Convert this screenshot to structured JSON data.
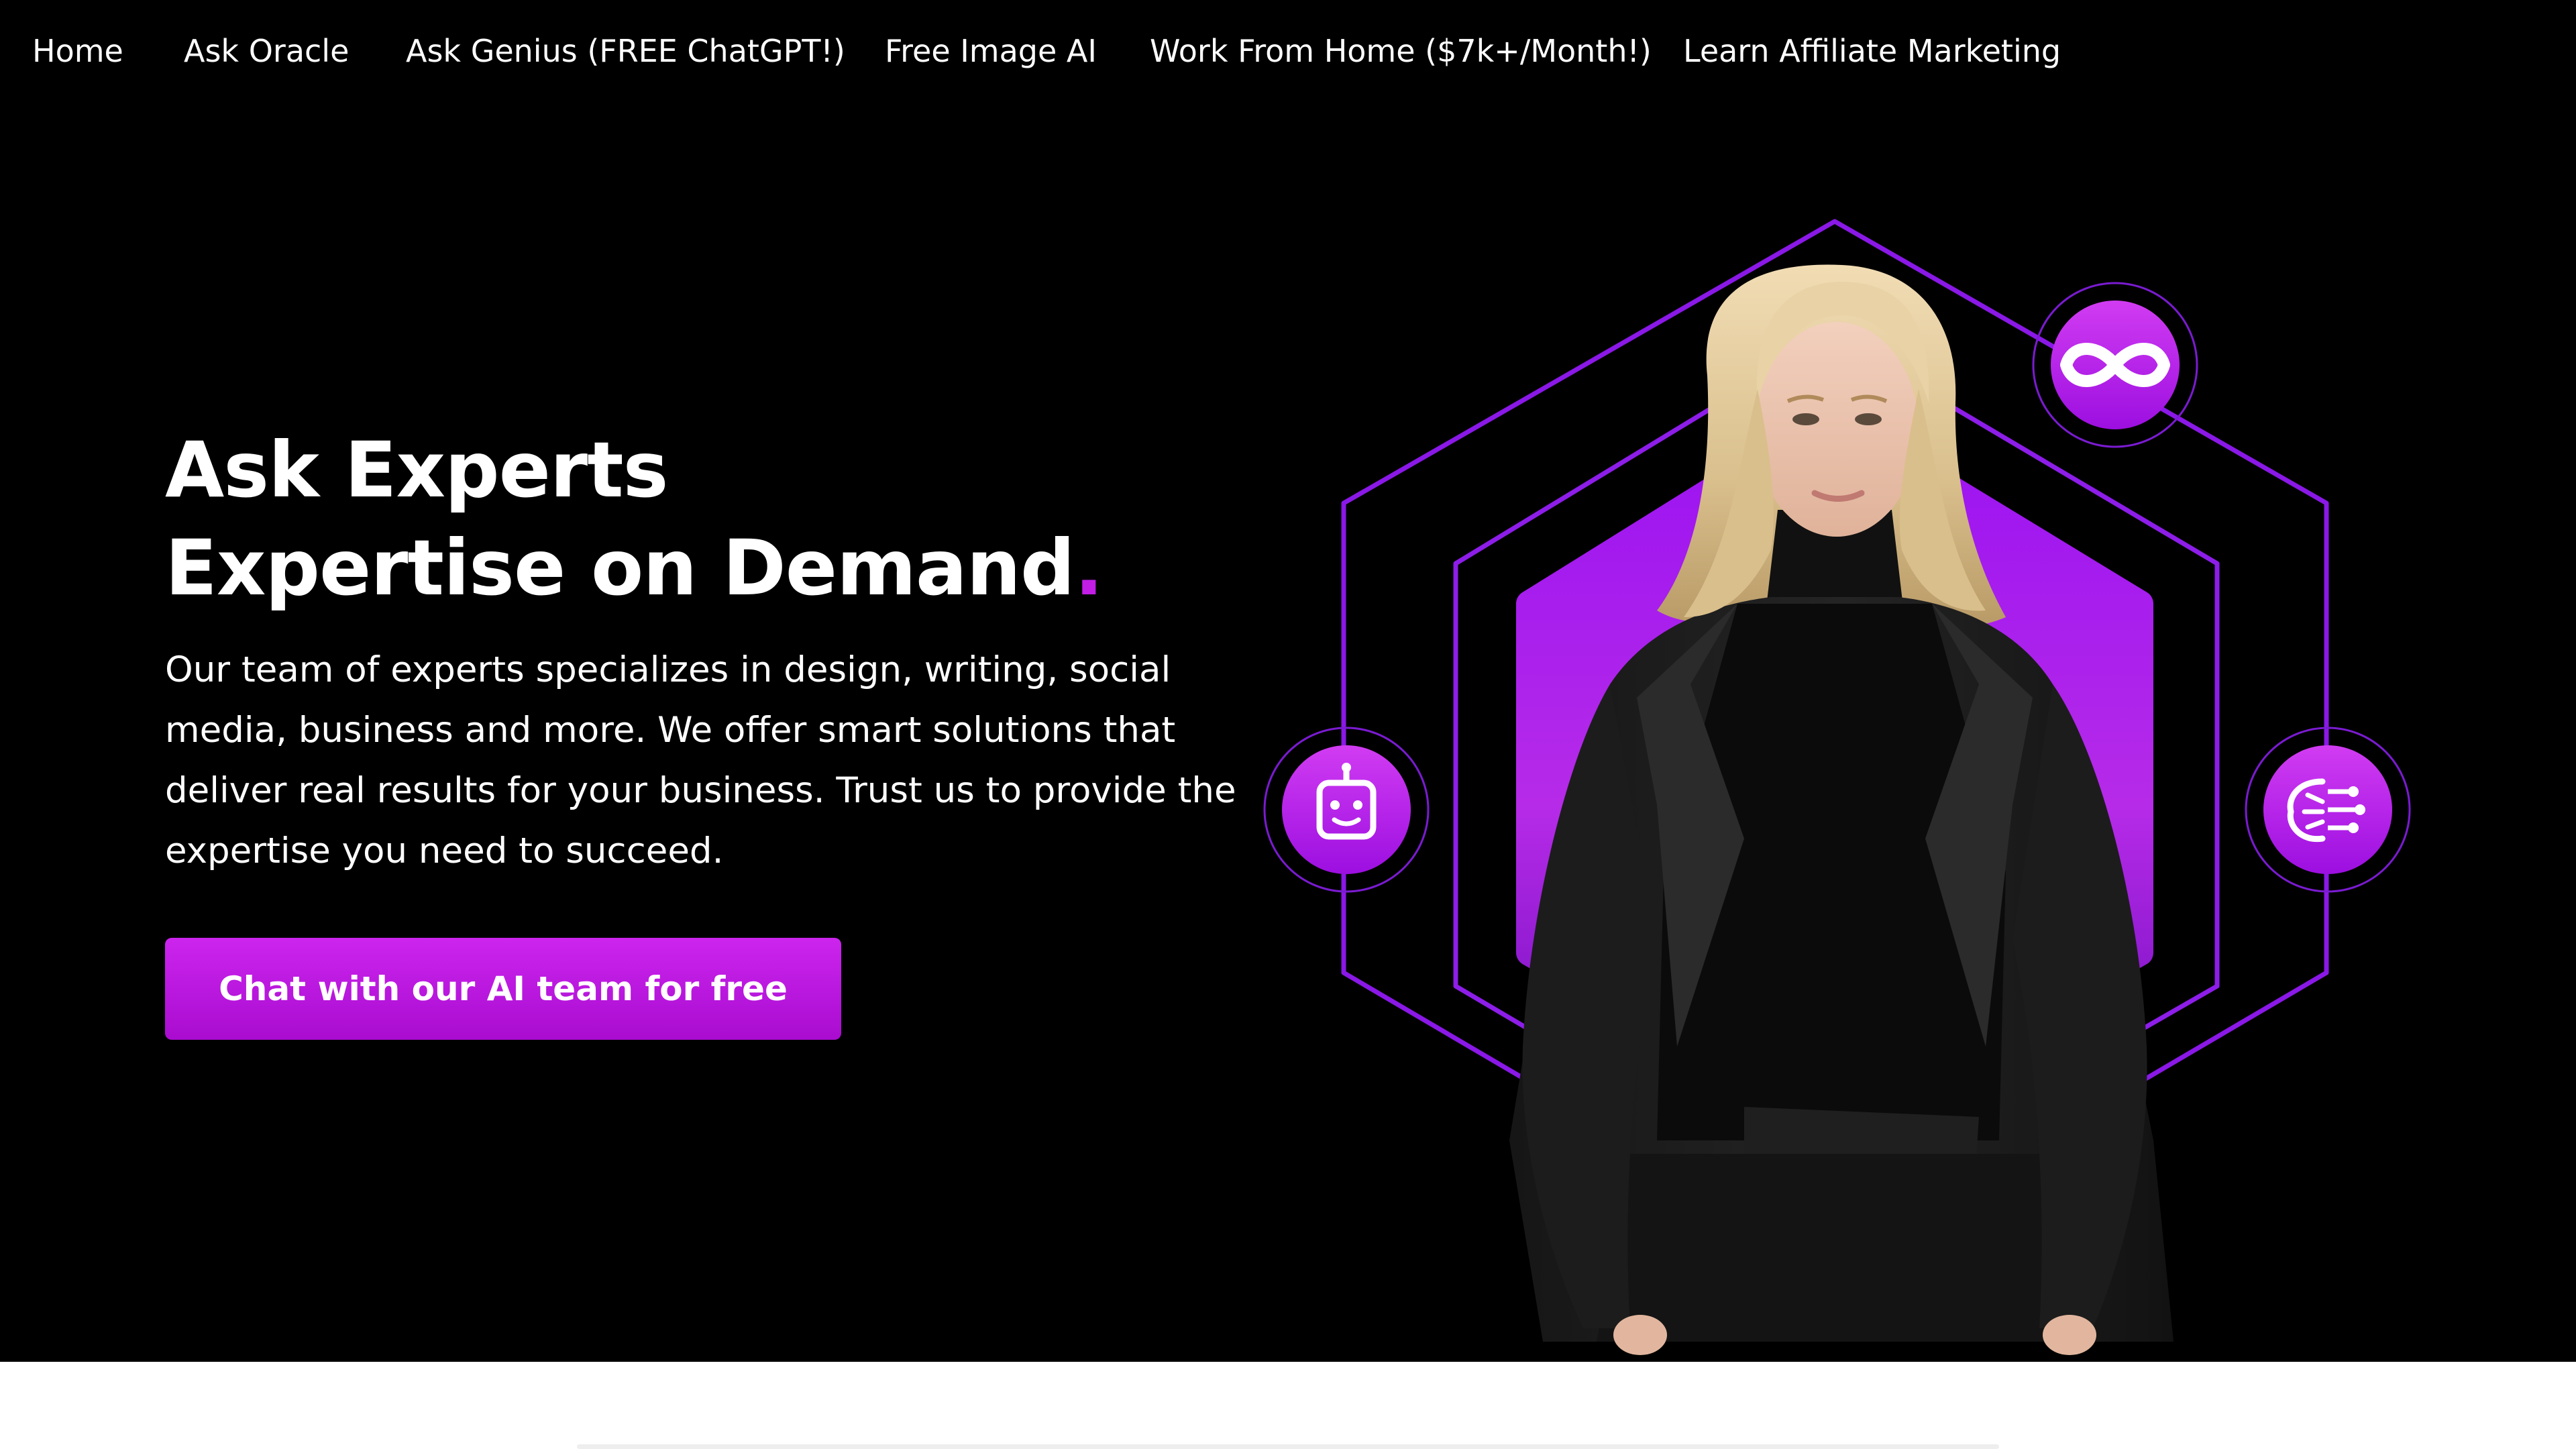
{
  "nav": {
    "items": [
      {
        "label": "Home"
      },
      {
        "label": "Ask Oracle"
      },
      {
        "label": "Ask Genius (FREE ChatGPT!)"
      },
      {
        "label": "Free Image AI"
      },
      {
        "label": "Work From Home ($7k+/Month!)"
      },
      {
        "label": "Learn Affiliate Marketing"
      }
    ]
  },
  "hero": {
    "headline_line1": "Ask Experts",
    "headline_line2": "Expertise on Demand",
    "headline_dot": ".",
    "description": "Our team of experts specializes in design, writing, social media, business and more. We offer smart solutions that deliver real results for your business. Trust us to provide the expertise you need to succeed.",
    "cta_label": "Chat with our AI team for free"
  },
  "graphic": {
    "icons": [
      "infinity-icon",
      "robot-icon",
      "ai-brain-icon"
    ],
    "person": "expert-portrait"
  },
  "colors": {
    "background": "#000000",
    "accent": "#c21ee6",
    "accent_dark": "#8a0ed8",
    "text": "#ffffff"
  }
}
